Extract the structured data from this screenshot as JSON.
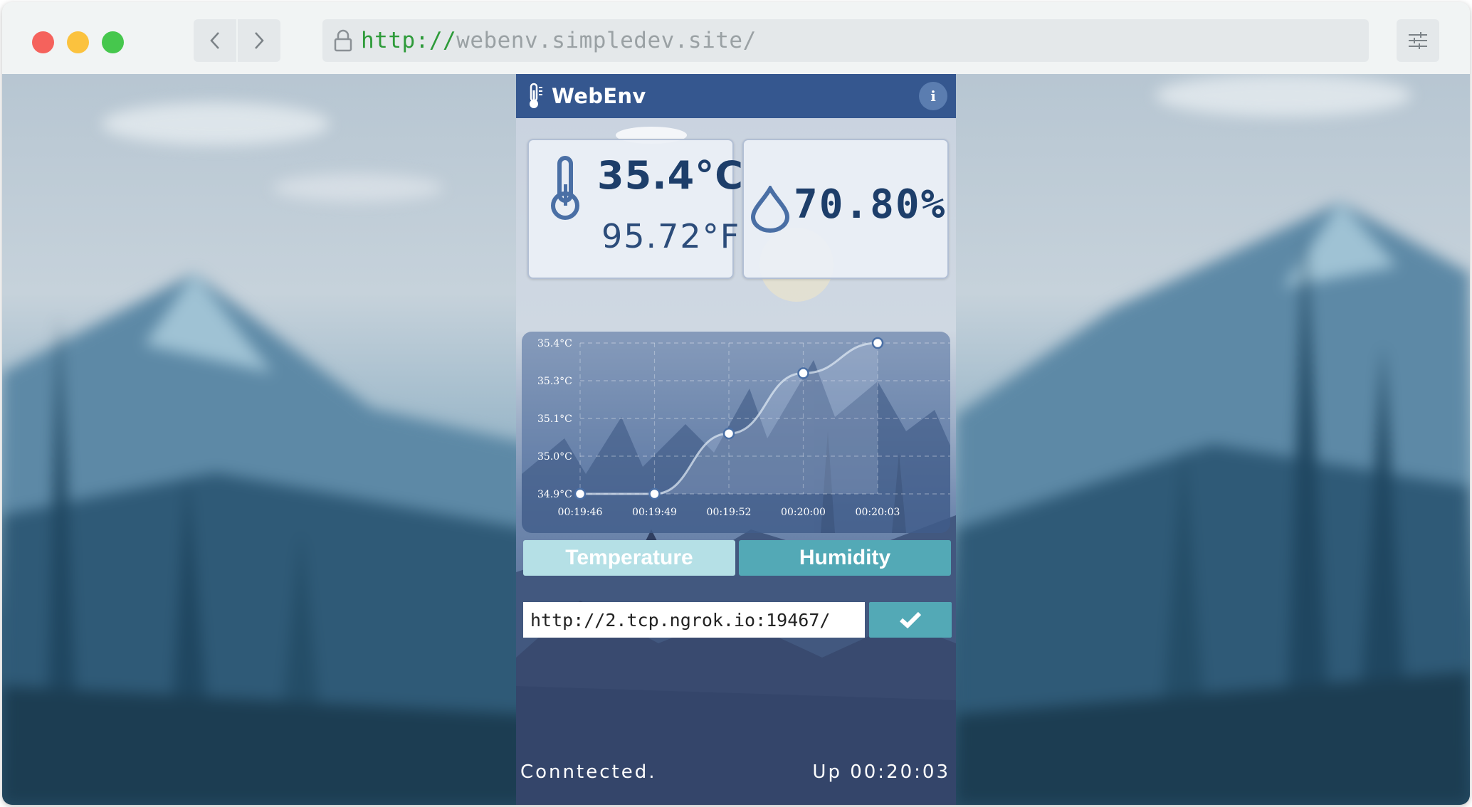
{
  "browser": {
    "url_protocol": "http://",
    "url_host": "webenv.simpledev.site/",
    "icons": {
      "back": "chevron-left-icon",
      "forward": "chevron-right-icon",
      "lock": "lock-icon",
      "menu": "sliders-icon"
    }
  },
  "app": {
    "title": "WebEnv",
    "info_label": "i",
    "colors": {
      "header": "#35578f",
      "accent": "#53a9b6",
      "accent_light": "#b5e0e6",
      "value_text": "#1d3e6a"
    }
  },
  "readings": {
    "temperature_c": "35.4°C",
    "temperature_f": "95.72°F",
    "humidity": "70.80%"
  },
  "chart_data": {
    "type": "line",
    "x": [
      "00:19:46",
      "00:19:49",
      "00:19:52",
      "00:20:00",
      "00:20:03"
    ],
    "values": [
      34.9,
      34.9,
      35.1,
      35.3,
      35.4
    ],
    "ytick_labels": [
      "35.4°C",
      "35.3°C",
      "35.1°C",
      "35.0°C",
      "34.9°C"
    ],
    "ylim": [
      34.9,
      35.4
    ],
    "grid": true
  },
  "tabs": {
    "temperature": "Temperature",
    "humidity": "Humidity"
  },
  "endpoint": {
    "value": "http://2.tcp.ngrok.io:19467/"
  },
  "footer": {
    "status": "Conntected.",
    "uptime": "Up 00:20:03"
  }
}
